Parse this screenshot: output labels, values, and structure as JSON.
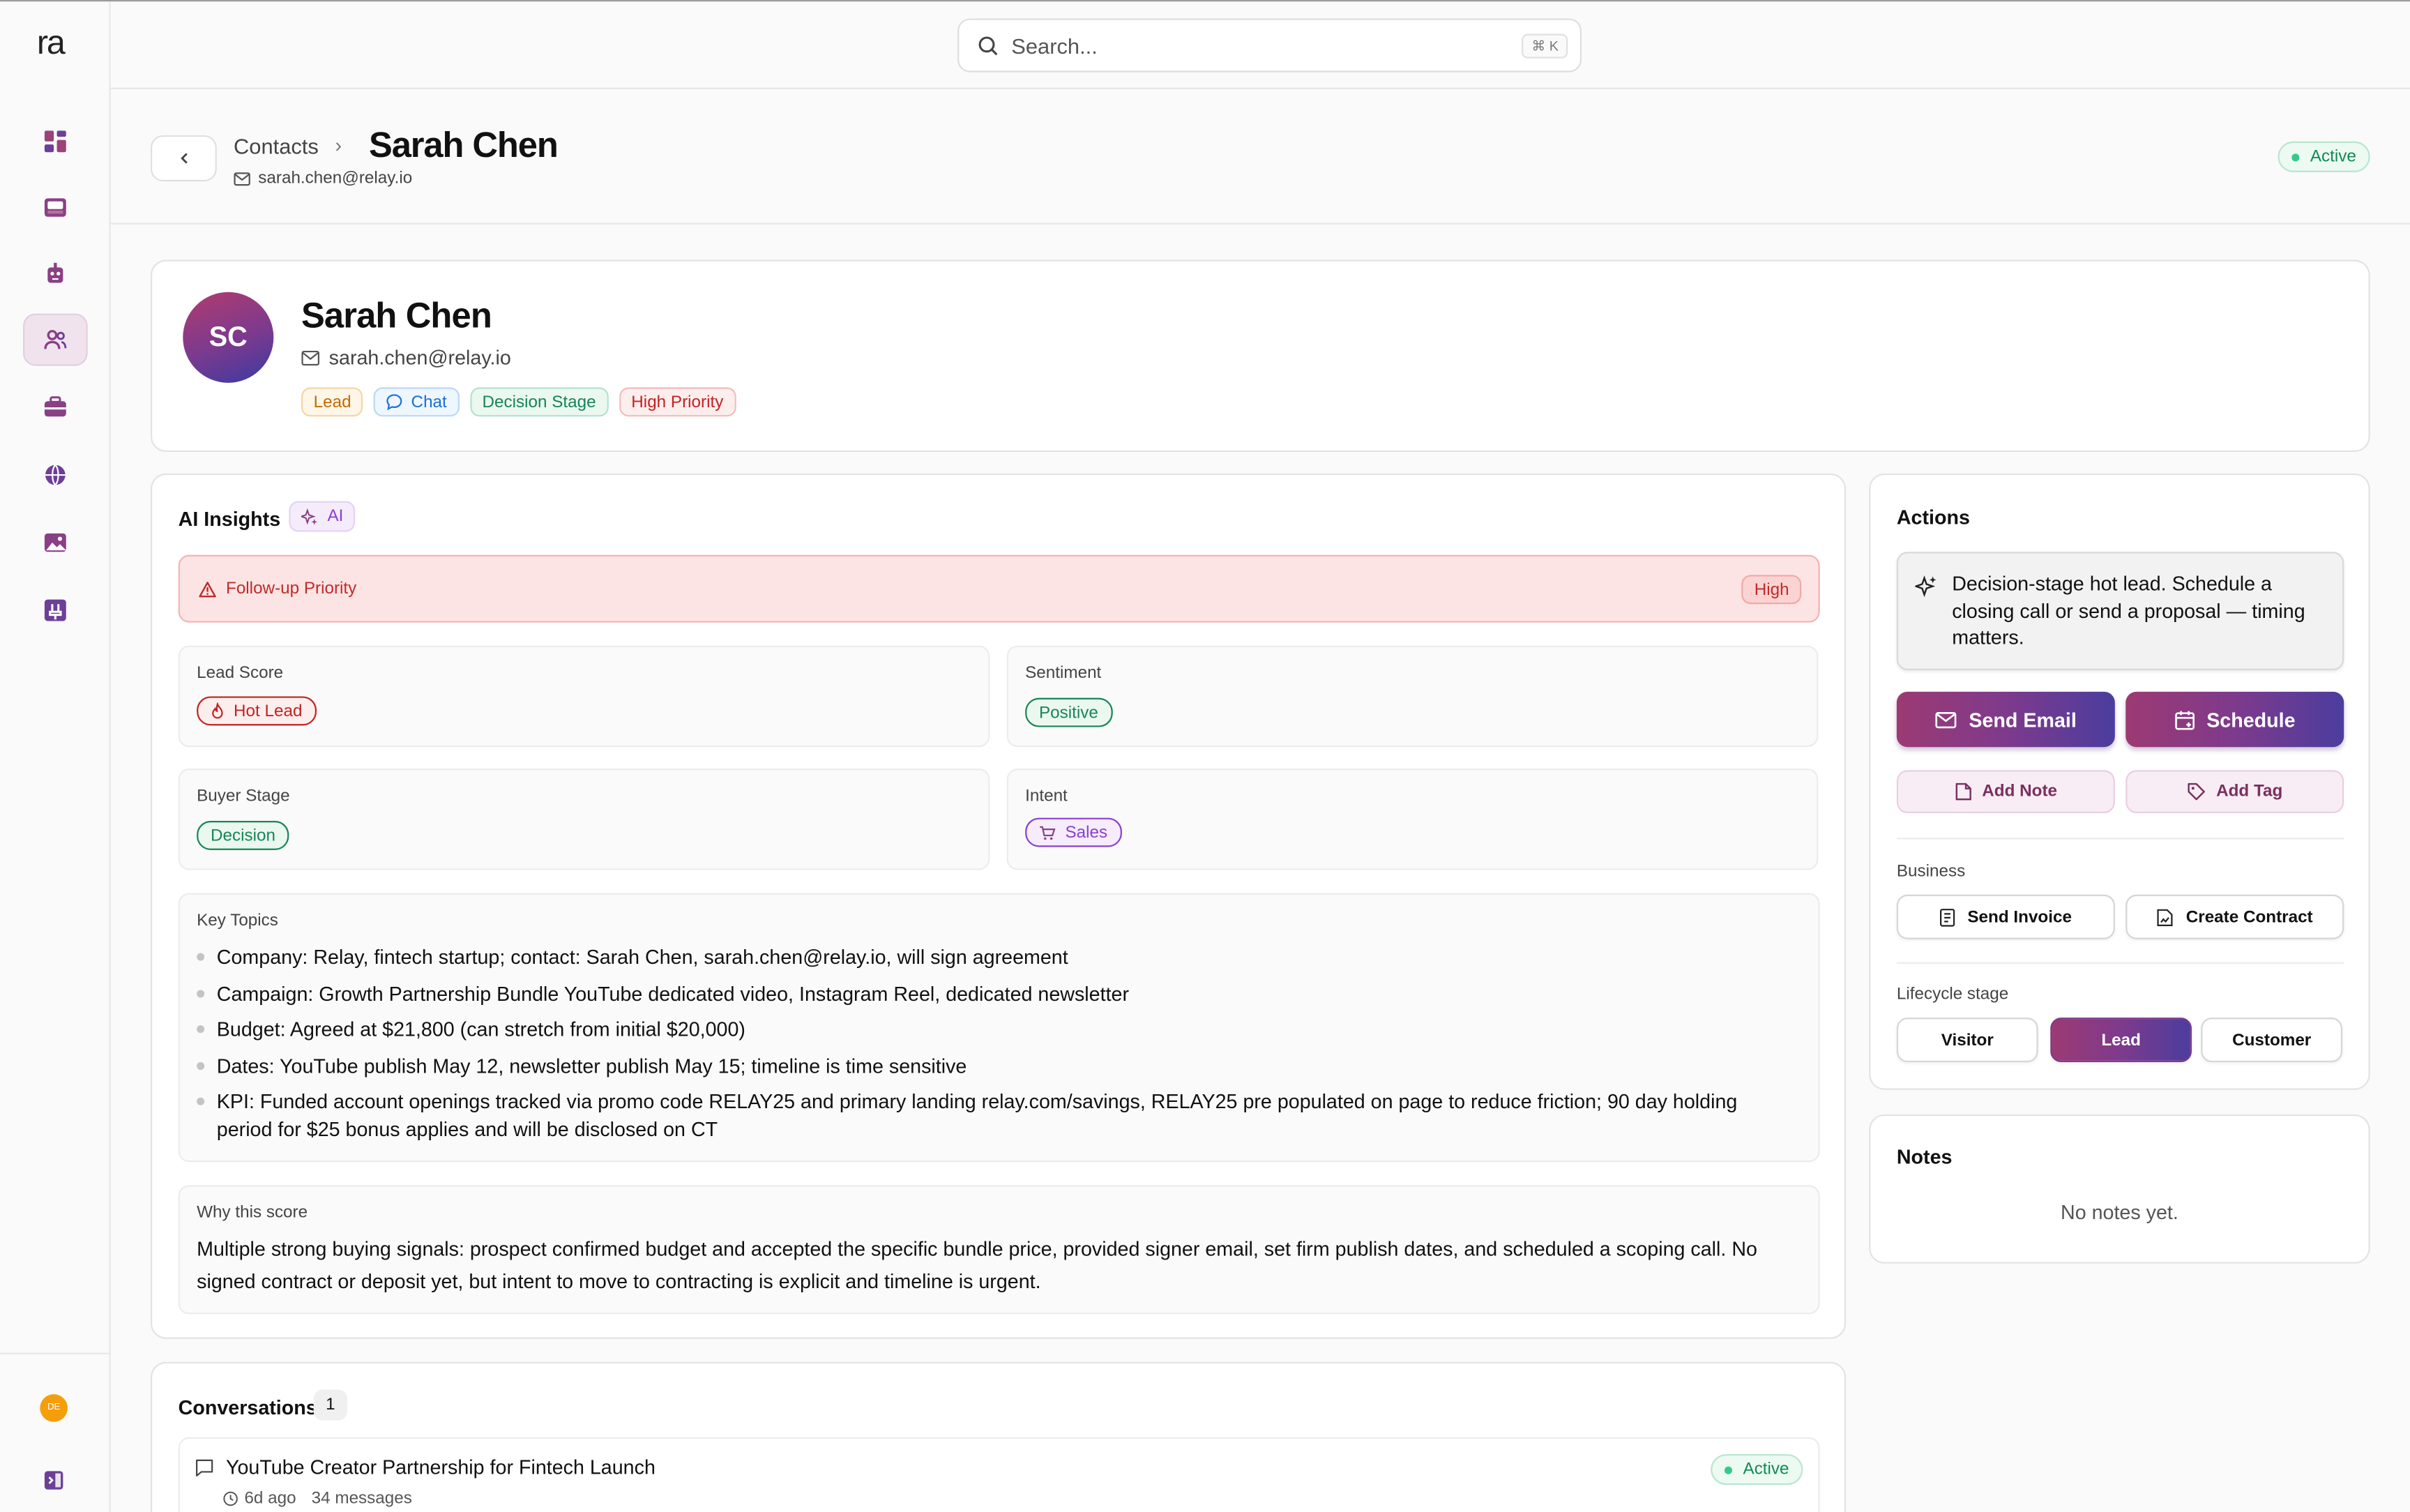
{
  "app": {
    "logo": "ra"
  },
  "sidebar": {
    "items": [
      {
        "icon": "dashboard-icon",
        "active": false
      },
      {
        "icon": "inbox-icon",
        "active": false
      },
      {
        "icon": "bot-icon",
        "active": false
      },
      {
        "icon": "contacts-icon",
        "active": true
      },
      {
        "icon": "briefcase-icon",
        "active": false
      },
      {
        "icon": "globe-icon",
        "active": false
      },
      {
        "icon": "image-icon",
        "active": false
      },
      {
        "icon": "plugin-icon",
        "active": false
      }
    ],
    "user_initials": "DE"
  },
  "search": {
    "placeholder": "Search...",
    "shortcut": "⌘ K"
  },
  "header": {
    "breadcrumb_parent": "Contacts",
    "title": "Sarah Chen",
    "email": "sarah.chen@relay.io",
    "status": "Active"
  },
  "profile": {
    "initials": "SC",
    "name": "Sarah Chen",
    "email": "sarah.chen@relay.io",
    "tags": {
      "lead": "Lead",
      "chat": "Chat",
      "stage": "Decision Stage",
      "priority": "High Priority"
    }
  },
  "insights": {
    "title": "AI Insights",
    "ai_badge": "AI",
    "priority_label": "Follow-up Priority",
    "priority_value": "High",
    "lead_score_label": "Lead Score",
    "lead_score_value": "Hot Lead",
    "sentiment_label": "Sentiment",
    "sentiment_value": "Positive",
    "buyer_stage_label": "Buyer Stage",
    "buyer_stage_value": "Decision",
    "intent_label": "Intent",
    "intent_value": "Sales",
    "topics_label": "Key Topics",
    "topics": [
      "Company: Relay, fintech startup; contact: Sarah Chen, sarah.chen@relay.io, will sign agreement",
      "Campaign: Growth Partnership Bundle YouTube dedicated video, Instagram Reel, dedicated newsletter",
      "Budget: Agreed at $21,800 (can stretch from initial $20,000)",
      "Dates: YouTube publish May 12, newsletter publish May 15; timeline is time sensitive",
      "KPI: Funded account openings tracked via promo code RELAY25 and primary landing relay.com/savings, RELAY25 pre populated on page to reduce friction; 90 day holding period for $25 bonus applies and will be disclosed on CT"
    ],
    "why_label": "Why this score",
    "why_text": "Multiple strong buying signals: prospect confirmed budget and accepted the specific bundle price, provided signer email, set firm publish dates, and scheduled a scoping call. No signed contract or deposit yet, but intent to move to contracting is explicit and timeline is urgent."
  },
  "actions": {
    "title": "Actions",
    "hint": "Decision-stage hot lead. Schedule a closing call or send a proposal — timing matters.",
    "send_email": "Send Email",
    "schedule": "Schedule",
    "add_note": "Add Note",
    "add_tag": "Add Tag",
    "business_label": "Business",
    "send_invoice": "Send Invoice",
    "create_contract": "Create Contract",
    "lifecycle_label": "Lifecycle stage",
    "lifecycle": [
      "Visitor",
      "Lead",
      "Customer"
    ],
    "lifecycle_selected": "Lead"
  },
  "notes": {
    "title": "Notes",
    "empty": "No notes yet."
  },
  "conversations": {
    "title": "Conversations",
    "count": "1",
    "items": [
      {
        "title": "YouTube Creator Partnership for Fintech Launch",
        "age": "6d ago",
        "messages": "34 messages",
        "status": "Active"
      }
    ]
  },
  "colors": {
    "accent_gradient_start": "#9c3a73",
    "accent_gradient_end": "#4b3d9e",
    "active_green": "#0f8a55",
    "danger_red": "#c12a2a"
  }
}
